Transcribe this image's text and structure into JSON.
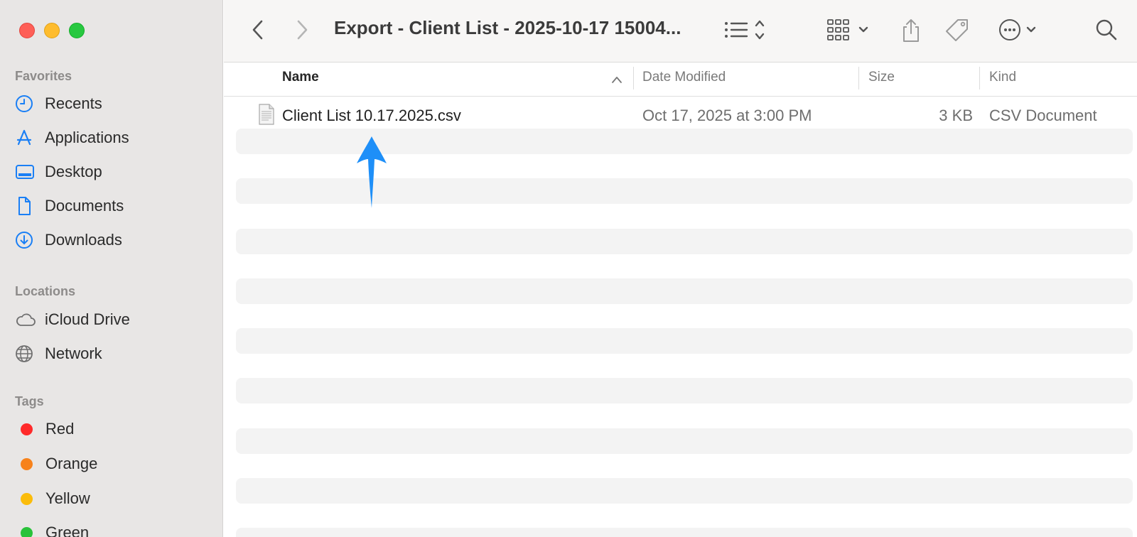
{
  "window": {
    "title": "Export - Client List - 2025-10-17 15004..."
  },
  "colors": {
    "accent": "#1a7ff5",
    "sidebar_bg": "#e8e6e5",
    "annotation_arrow": "#1e8ff8"
  },
  "sidebar": {
    "favorites_title": "Favorites",
    "favorites": [
      {
        "label": "Recents",
        "icon": "clock-icon"
      },
      {
        "label": "Applications",
        "icon": "applications-icon"
      },
      {
        "label": "Desktop",
        "icon": "desktop-icon"
      },
      {
        "label": "Documents",
        "icon": "document-icon"
      },
      {
        "label": "Downloads",
        "icon": "download-icon"
      }
    ],
    "locations_title": "Locations",
    "locations": [
      {
        "label": "iCloud Drive",
        "icon": "cloud-icon"
      },
      {
        "label": "Network",
        "icon": "globe-icon"
      }
    ],
    "tags_title": "Tags",
    "tags": [
      {
        "label": "Red",
        "color": "#ff2a2a"
      },
      {
        "label": "Orange",
        "color": "#f7821b"
      },
      {
        "label": "Yellow",
        "color": "#fbbc0a"
      },
      {
        "label": "Green",
        "color": "#29c23a"
      }
    ]
  },
  "columns": {
    "name": "Name",
    "date_modified": "Date Modified",
    "size": "Size",
    "kind": "Kind"
  },
  "files": [
    {
      "name": "Client List 10.17.2025.csv",
      "date_modified": "Oct 17, 2025 at 3:00 PM",
      "size": "3 KB",
      "kind": "CSV Document"
    }
  ]
}
